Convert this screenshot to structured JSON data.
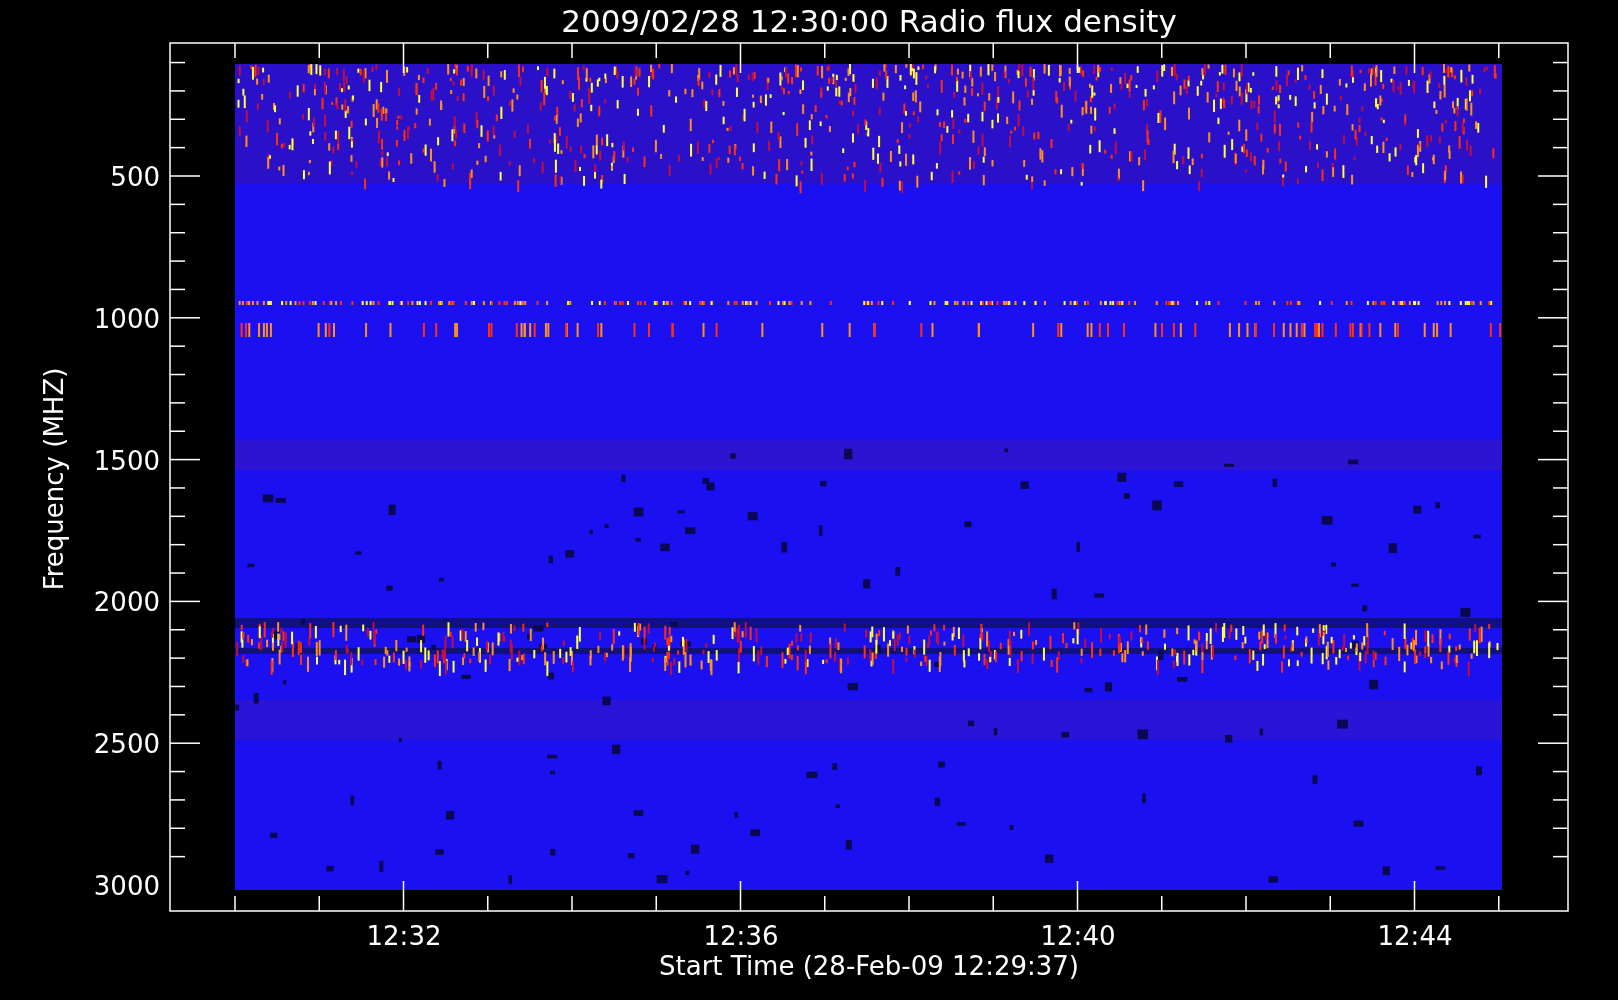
{
  "plot": {
    "title": "2009/02/28 12:30:00 Radio flux density",
    "ylabel": "Frequency (MHZ)",
    "xlabel": "Start Time (28-Feb-09 12:29:37)",
    "yticks": [
      "500",
      "1000",
      "1500",
      "2000",
      "2500",
      "3000"
    ],
    "xticks": [
      "12:32",
      "12:36",
      "12:40",
      "12:44"
    ]
  }
}
